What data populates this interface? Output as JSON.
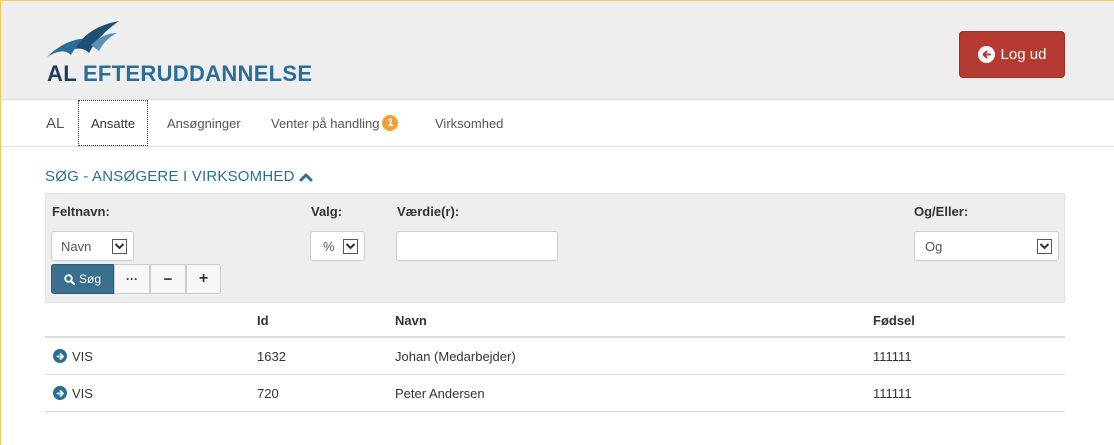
{
  "header": {
    "logo_al": "AL",
    "logo_rest": "EFTERUDDANNELSE",
    "logout_label": "Log ud"
  },
  "nav": {
    "brand": "AL",
    "items": [
      {
        "label": "Ansatte",
        "active": true
      },
      {
        "label": "Ansøgninger"
      },
      {
        "label": "Venter på handling",
        "badge": "1"
      },
      {
        "label": "Virksomhed"
      }
    ]
  },
  "search": {
    "title": "SØG - ANSØGERE I VIRKSOMHED",
    "labels": {
      "feltnavn": "Feltnavn:",
      "valg": "Valg:",
      "vaerdi": "Værdie(r):",
      "og_eller": "Og/Eller:"
    },
    "feltnavn_value": "Navn",
    "valg_value": "%",
    "vaerdi_value": "",
    "og_eller_value": "Og",
    "search_button": "Søg",
    "more_button": "···",
    "minus_button": "−",
    "plus_button": "+"
  },
  "table": {
    "columns": [
      "",
      "Id",
      "Navn",
      "Fødsel"
    ],
    "rows": [
      {
        "action": "VIS",
        "id": "1632",
        "navn": "Johan (Medarbejder)",
        "foedsel": "111111"
      },
      {
        "action": "VIS",
        "id": "720",
        "navn": "Peter Andersen",
        "foedsel": "111111"
      }
    ]
  },
  "colors": {
    "accent": "#2a6d96",
    "logout": "#b43a32",
    "search_button": "#3b6f90",
    "badge": "#f0a030"
  },
  "icons": {
    "logo": "bird-logo-icon",
    "logout": "arrow-left-circle-icon",
    "section_toggle": "chevron-up-icon",
    "search": "search-icon",
    "row_action": "arrow-right-circle-icon",
    "select_arrow": "chevron-down-icon"
  }
}
